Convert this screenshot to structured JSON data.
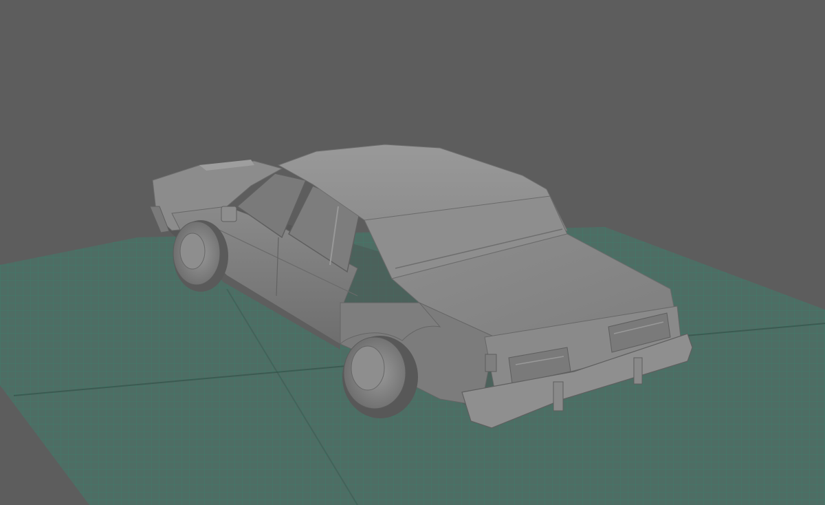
{
  "viewport": {
    "background_color": "#5d5d5d",
    "grid_color": "#3f7a6a",
    "grid_fill_color": "#4e6d64",
    "model_color": "#8b8b8b",
    "model_shadow_color": "#6f6f6f",
    "model_highlight_color": "#a2a2a2"
  },
  "scene": {
    "object": "car-model",
    "view": "perspective",
    "display_mode": "smooth-shaded",
    "grid_visible": true
  }
}
